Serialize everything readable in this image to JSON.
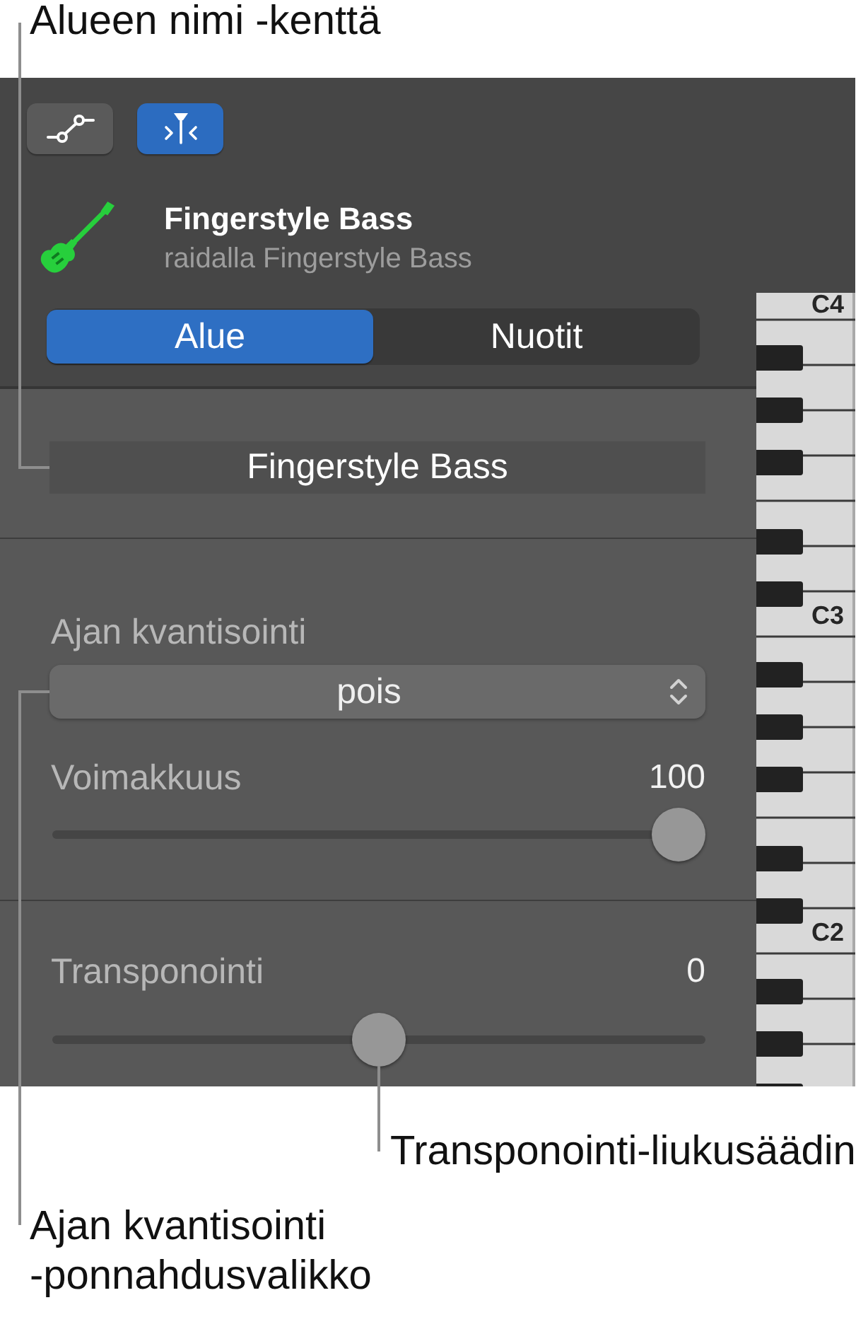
{
  "callouts": {
    "region_name_field": "Alueen nimi -kenttä",
    "transpose_slider": "Transponointi-liukusäädin",
    "quantize_popup": "Ajan kvantisointi\n-ponnahdusvalikko"
  },
  "toolbar": [
    {
      "kind": "nodes",
      "selected": false
    },
    {
      "kind": "pin",
      "selected": true
    }
  ],
  "track": {
    "name": "Fingerstyle Bass",
    "subtitle": "raidalla Fingerstyle Bass"
  },
  "segments": [
    {
      "label": "Alue",
      "selected": true
    },
    {
      "label": "Nuotit",
      "selected": false
    }
  ],
  "region_name": {
    "value": "Fingerstyle Bass"
  },
  "groups": [
    {
      "controls": [
        {
          "kind": "popup",
          "label": "Ajan kvantisointi",
          "value": "pois"
        },
        {
          "kind": "slider",
          "label": "Voimakkuus",
          "reading": "100",
          "level": 1
        }
      ]
    },
    {
      "controls": [
        {
          "kind": "slider",
          "label": "Transponointi",
          "reading": "0",
          "level": 0.5
        }
      ]
    }
  ],
  "keyboard": {
    "labels": [
      "C4",
      "C3",
      "C2"
    ]
  }
}
